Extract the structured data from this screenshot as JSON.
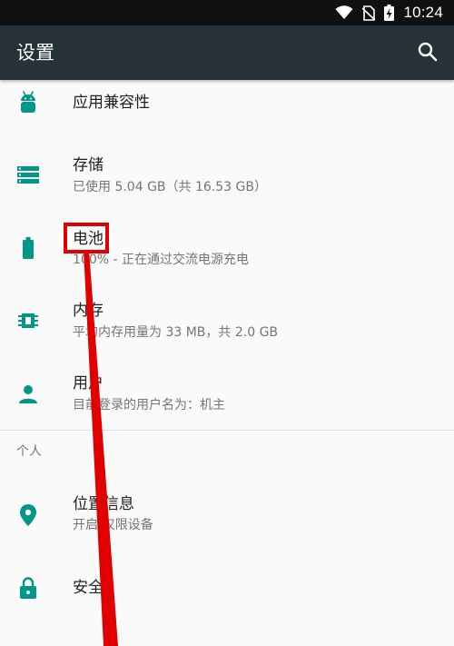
{
  "status_bar": {
    "time": "10:24",
    "icons": [
      "wifi-icon",
      "no-sim-icon",
      "battery-charging-icon"
    ]
  },
  "app_bar": {
    "title": "设置",
    "search_icon": "search-icon"
  },
  "items": [
    {
      "label": "应用兼容性",
      "sub": "",
      "icon": "android-icon"
    },
    {
      "label": "存储",
      "sub": "已使用 5.04 GB（共 16.53 GB）",
      "icon": "storage-icon"
    },
    {
      "label": "电池",
      "sub": "100% - 正在通过交流电源充电",
      "icon": "battery-icon"
    },
    {
      "label": "内存",
      "sub": "平均内存用量为 33 MB，共 2.0 GB",
      "icon": "memory-icon"
    },
    {
      "label": "用户",
      "sub": "目前登录的用户名为：机主",
      "icon": "person-icon"
    }
  ],
  "section_personal": {
    "header": "个人",
    "items": [
      {
        "label": "位置信息",
        "sub": "开启/仅限设备",
        "icon": "location-icon"
      },
      {
        "label": "安全",
        "sub": "",
        "icon": "lock-icon"
      }
    ]
  },
  "colors": {
    "status_bar": "#111111",
    "app_bar": "#263238",
    "accent_icon": "#009688",
    "annotation": "#E00000"
  }
}
